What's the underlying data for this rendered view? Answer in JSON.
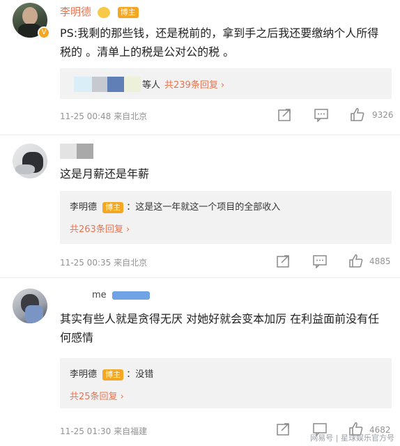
{
  "comments": [
    {
      "author": "李明德",
      "badge": "博主",
      "text": "PS:我剩的那些钱，还是税前的，拿到手之后我还要缴纳个人所得税的 。清单上的税是公对公的税 。",
      "reply_snippet": "等人",
      "reply_count_label": "共239条回复",
      "meta": "11-25 00:48  来自北京",
      "likes": "9326"
    },
    {
      "author": "",
      "text": "这是月薪还是年薪",
      "reply_author": "李明德",
      "reply_badge": "博主",
      "reply_text": "：这是这一年就这一个项目的全部收入",
      "reply_count_label": "共263条回复",
      "meta": "11-25 00:35  来自北京",
      "likes": "4885"
    },
    {
      "author": "me",
      "text": "其实有些人就是贪得无厌 对她好就会变本加厉 在利益面前没有任何感情",
      "reply_author": "李明德",
      "reply_badge": "博主",
      "reply_text": "：没错",
      "reply_count_label": "共25条回复",
      "meta": "11-25 01:30  来自福建",
      "likes": "4682"
    }
  ],
  "watermark": "网易号 | 星球娱乐官方号",
  "colors": {
    "accent": "#eb7350",
    "badge": "#f5a623",
    "meta": "#939393",
    "replybg": "#f2f2f2"
  },
  "icons": [
    "share-icon",
    "comment-icon",
    "like-icon"
  ]
}
